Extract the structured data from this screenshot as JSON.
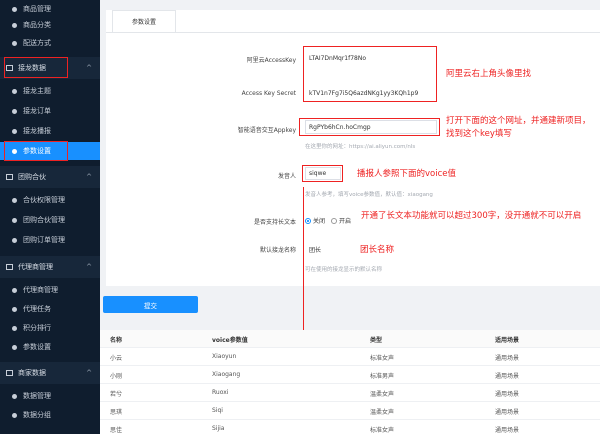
{
  "sidebar": {
    "top_items": [
      "商品管理",
      "商品分类",
      "配送方式"
    ],
    "groups": [
      {
        "label": "接龙数据",
        "items": [
          "接龙主题",
          "接龙订单",
          "接龙播报",
          "参数设置"
        ]
      },
      {
        "label": "团购合伙",
        "items": [
          "合伙权限管理",
          "团购合伙管理",
          "团购订单管理"
        ]
      },
      {
        "label": "代理商管理",
        "items": [
          "代理商管理",
          "代理任务",
          "积分排行",
          "参数设置"
        ]
      },
      {
        "label": "商家数据",
        "items": [
          "数据管理",
          "数据分组"
        ]
      }
    ]
  },
  "tab": {
    "label": "参数设置"
  },
  "form": {
    "access_key_label": "阿里云AccessKey",
    "access_key_value": "LTAI7DnMqr1f78No",
    "secret_label": "Access Key Secret",
    "secret_value": "kTV1n7Fg7i5Q6azdNKg1yy3KQh1p9",
    "appkey_label": "智能语音交互Appkey",
    "appkey_value": "RgPYb6hCn.hoCmgp",
    "appkey_hint": "在这里你的网址：https://ai.aliyun.com/nls",
    "speaker_label": "发音人",
    "speaker_value": "siqwe",
    "speaker_hint": "发音人参考，填写voice参数值，默认值：xiaogang",
    "long_text_label": "是否支持长文本",
    "radio_off": "关闭",
    "radio_on": "开启",
    "group_name_label": "默认接龙名称",
    "group_name_value": "团长",
    "group_name_hint": "可在使用的接龙显示的默认名称"
  },
  "annotations": {
    "a1": "阿里云右上角头像里找",
    "a2": "打开下面的这个网址，并通建新项目，找到这个key填写",
    "a3": "播报人参照下面的voice值",
    "a4": "开通了长文本功能就可以超过300字，没开通就不可以开启",
    "a5": "团长名称"
  },
  "submit_label": "提交",
  "table": {
    "headers": [
      "名称",
      "voice参数值",
      "类型",
      "适用场景"
    ],
    "rows": [
      [
        "小云",
        "Xiaoyun",
        "标准女声",
        "通用场景"
      ],
      [
        "小刚",
        "Xiaogang",
        "标准男声",
        "通用场景"
      ],
      [
        "若兮",
        "Ruoxi",
        "温柔女声",
        "通用场景"
      ],
      [
        "思琪",
        "Siqi",
        "温柔女声",
        "通用场景"
      ],
      [
        "思佳",
        "Sijia",
        "标准女声",
        "通用场景"
      ]
    ]
  },
  "colors": {
    "sidebar_bg": "#0f1d2e",
    "accent": "#1890ff",
    "annotation": "#ee2222"
  }
}
